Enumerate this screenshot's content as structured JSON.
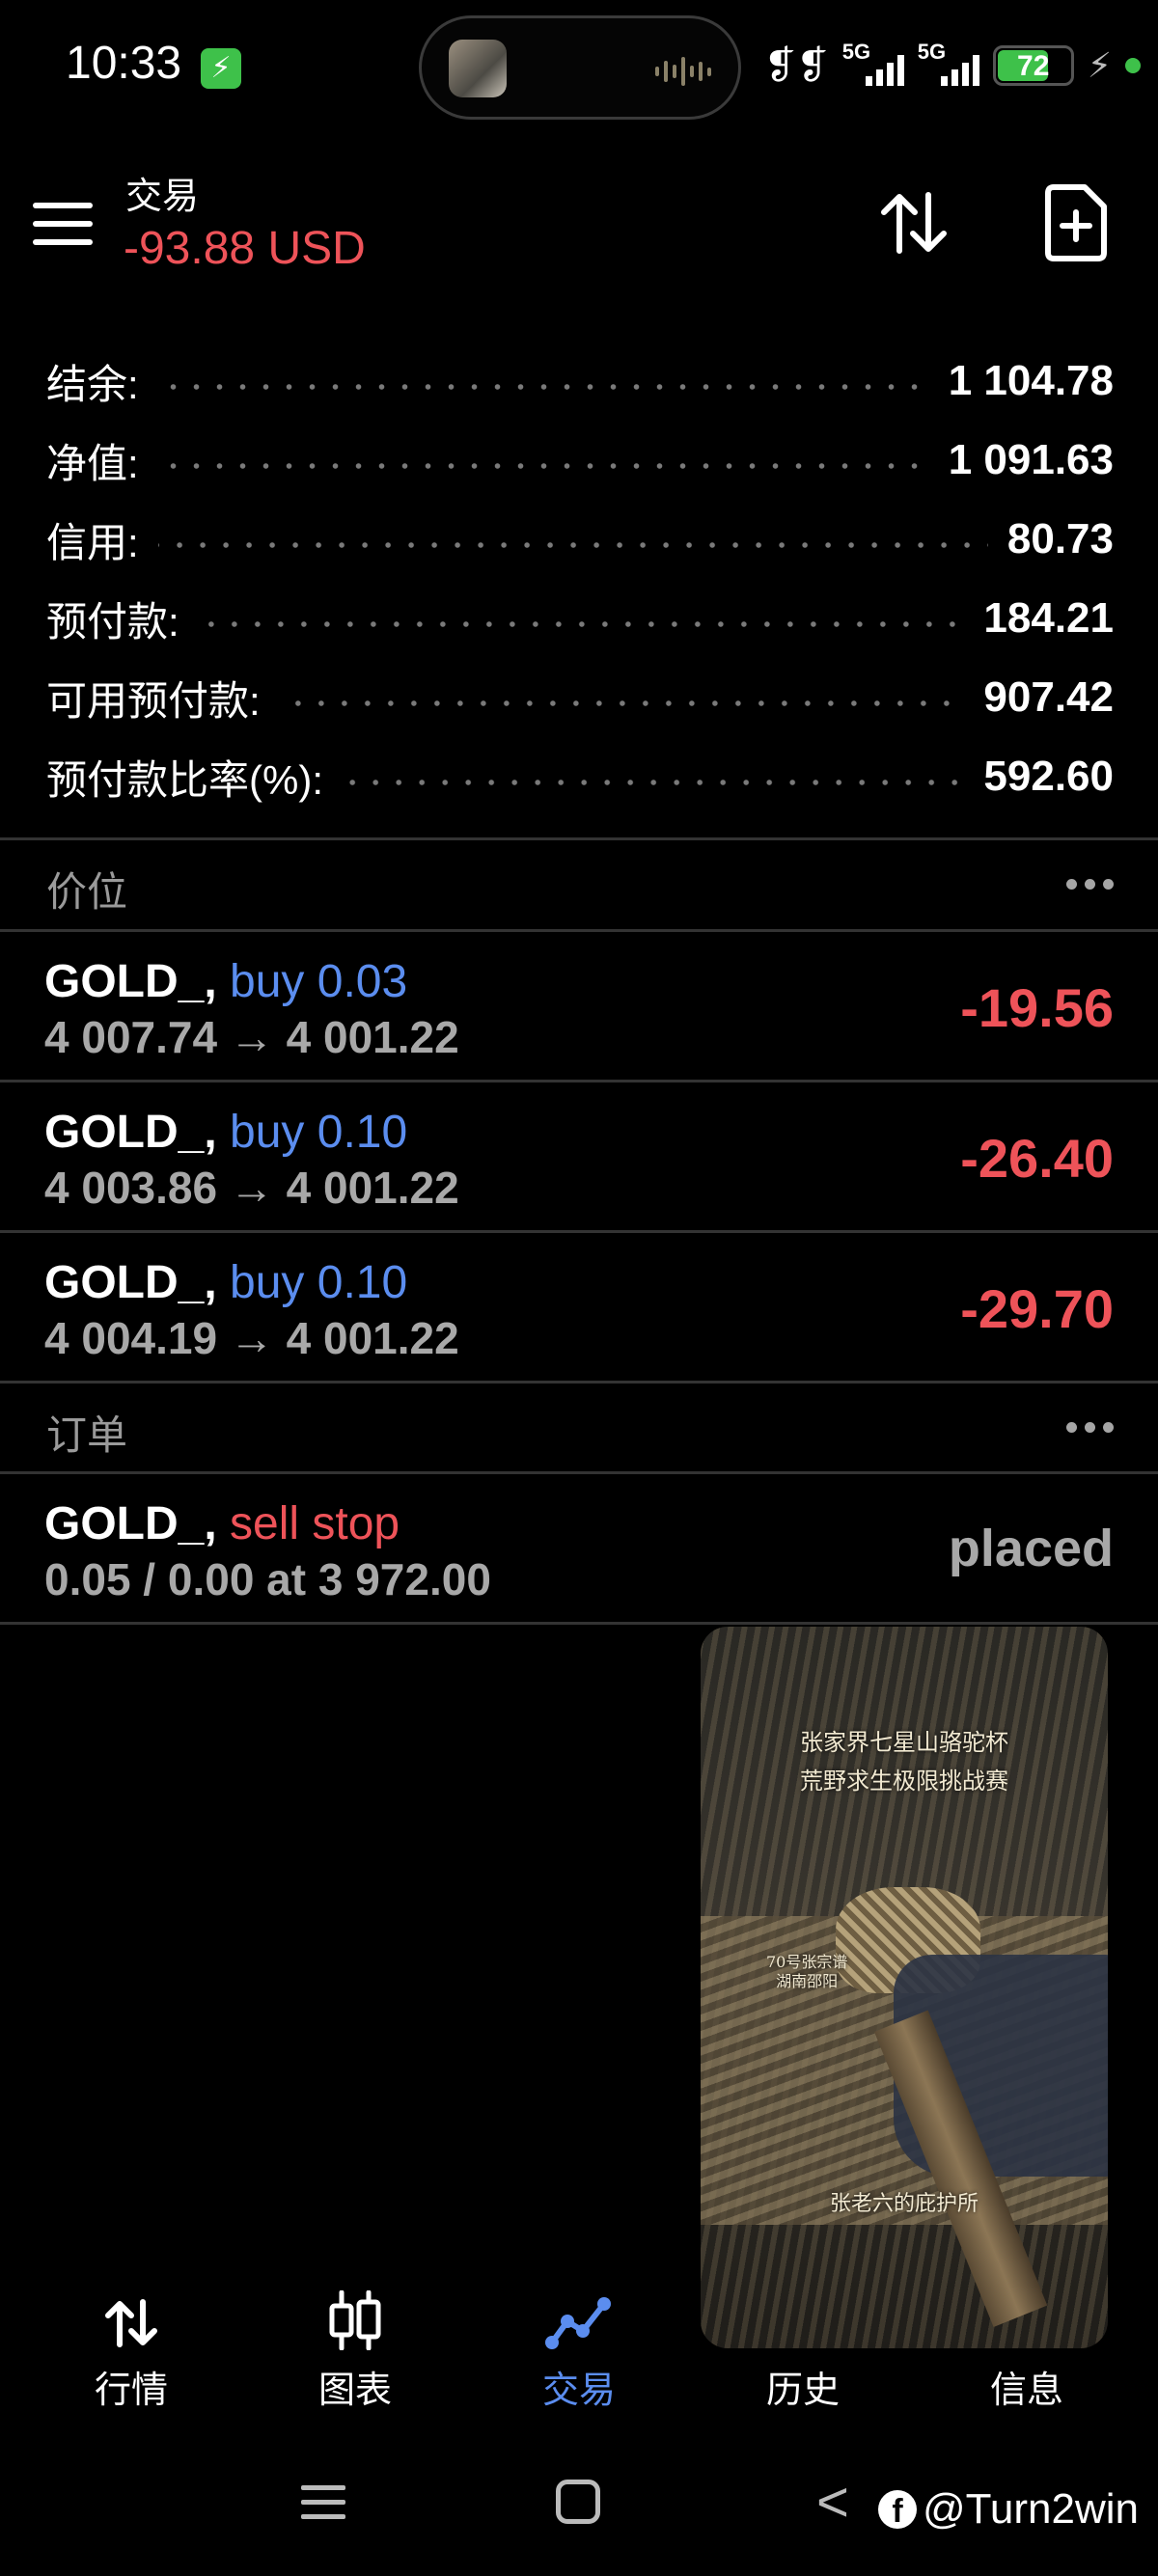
{
  "status_bar": {
    "time": "10:33",
    "network1": "5G",
    "network2": "5G",
    "battery": "72",
    "battery_level_pct": 72
  },
  "header": {
    "title": "交易",
    "profit": "-93.88 USD"
  },
  "summary": [
    {
      "label": "结余:",
      "value": "1 104.78"
    },
    {
      "label": "净值:",
      "value": "1 091.63"
    },
    {
      "label": "信用:",
      "value": "80.73"
    },
    {
      "label": "预付款:",
      "value": "184.21"
    },
    {
      "label": "可用预付款:",
      "value": "907.42"
    },
    {
      "label": "预付款比率(%):",
      "value": "592.60"
    }
  ],
  "positions_section": {
    "title": "价位"
  },
  "positions": [
    {
      "symbol": "GOLD_,",
      "side": "buy 0.03",
      "prices": "4 007.74 → 4 001.22",
      "profit": "-19.56"
    },
    {
      "symbol": "GOLD_,",
      "side": "buy 0.10",
      "prices": "4 003.86 → 4 001.22",
      "profit": "-26.40"
    },
    {
      "symbol": "GOLD_,",
      "side": "buy 0.10",
      "prices": "4 004.19 → 4 001.22",
      "profit": "-29.70"
    }
  ],
  "orders_section": {
    "title": "订单"
  },
  "orders": [
    {
      "symbol": "GOLD_,",
      "side": "sell stop",
      "detail": "0.05 / 0.00 at 3 972.00",
      "status": "placed"
    }
  ],
  "video_overlay": {
    "caption_line1": "张家界七星山骆驼杯",
    "caption_line2": "荒野求生极限挑战赛",
    "contestant_line1": "70号张宗谱",
    "contestant_line2": "湖南邵阳",
    "caption_bottom": "张老六的庇护所"
  },
  "bottom_nav": [
    {
      "label": "行情",
      "icon": "quotes-arrows-icon"
    },
    {
      "label": "图表",
      "icon": "candlestick-chart-icon"
    },
    {
      "label": "交易",
      "icon": "trade-line-icon",
      "active": true
    },
    {
      "label": "历史",
      "icon": "history-icon"
    },
    {
      "label": "信息",
      "icon": "messages-icon"
    }
  ],
  "watermark": "@Turn2win"
}
